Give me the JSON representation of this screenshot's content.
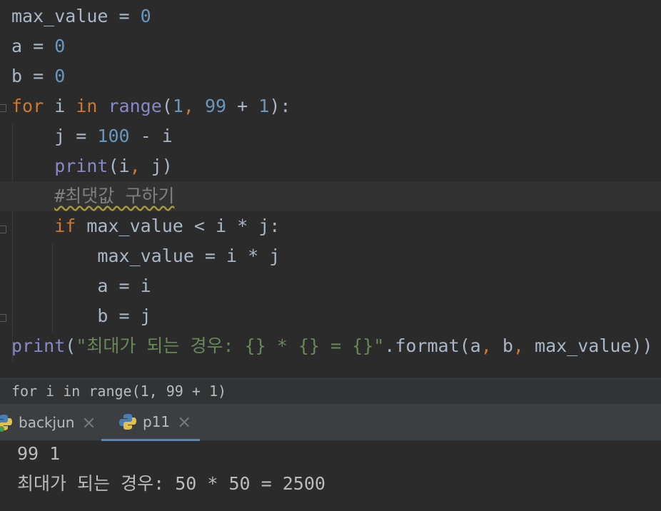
{
  "editor": {
    "lines": [
      {
        "segments": [
          {
            "t": "max_value = ",
            "c": "op"
          },
          {
            "t": "0",
            "c": "num"
          }
        ]
      },
      {
        "segments": [
          {
            "t": "a = ",
            "c": "op"
          },
          {
            "t": "0",
            "c": "num"
          }
        ]
      },
      {
        "segments": [
          {
            "t": "b = ",
            "c": "op"
          },
          {
            "t": "0",
            "c": "num"
          }
        ]
      },
      {
        "segments": [
          {
            "t": "for",
            "c": "kw"
          },
          {
            "t": " i ",
            "c": "op"
          },
          {
            "t": "in",
            "c": "kw"
          },
          {
            "t": " ",
            "c": "op"
          },
          {
            "t": "range",
            "c": "builtin"
          },
          {
            "t": "(",
            "c": "op"
          },
          {
            "t": "1",
            "c": "num"
          },
          {
            "t": ", ",
            "c": "kwcomma"
          },
          {
            "t": "99",
            "c": "num"
          },
          {
            "t": " + ",
            "c": "op"
          },
          {
            "t": "1",
            "c": "num"
          },
          {
            "t": "):",
            "c": "op"
          }
        ]
      },
      {
        "segments": [
          {
            "t": "    j = ",
            "c": "op"
          },
          {
            "t": "100",
            "c": "num"
          },
          {
            "t": " - i",
            "c": "op"
          }
        ]
      },
      {
        "segments": [
          {
            "t": "    ",
            "c": "op"
          },
          {
            "t": "print",
            "c": "builtin"
          },
          {
            "t": "(i",
            "c": "op"
          },
          {
            "t": ", ",
            "c": "kwcomma"
          },
          {
            "t": "j)",
            "c": "op"
          }
        ]
      },
      {
        "segments": [
          {
            "t": "    ",
            "c": "op"
          },
          {
            "t": "#최댓값 구하기",
            "c": "cmt"
          }
        ],
        "current": true
      },
      {
        "segments": [
          {
            "t": "    ",
            "c": "op"
          },
          {
            "t": "if",
            "c": "kw"
          },
          {
            "t": " max_value < i * j:",
            "c": "op"
          }
        ]
      },
      {
        "segments": [
          {
            "t": "        max_value = i * j",
            "c": "op"
          }
        ]
      },
      {
        "segments": [
          {
            "t": "        a = i",
            "c": "op"
          }
        ]
      },
      {
        "segments": [
          {
            "t": "        b = j",
            "c": "op"
          }
        ]
      },
      {
        "segments": [
          {
            "t": "print",
            "c": "builtin"
          },
          {
            "t": "(",
            "c": "op"
          },
          {
            "t": "\"최대가 되는 경우: {} * {} = {}\"",
            "c": "str"
          },
          {
            "t": ".format(a",
            "c": "op"
          },
          {
            "t": ", ",
            "c": "kwcomma"
          },
          {
            "t": "b",
            "c": "op"
          },
          {
            "t": ", ",
            "c": "kwcomma"
          },
          {
            "t": "max_value))",
            "c": "op"
          }
        ]
      }
    ]
  },
  "breadcrumb": {
    "text": "for i in range(1, 99 + 1)"
  },
  "tabs": {
    "items": [
      {
        "label": "backjun",
        "close": "×",
        "icon": "python-file-icon",
        "active": false
      },
      {
        "label": "p11",
        "close": "×",
        "icon": "python-file-icon",
        "active": true
      }
    ]
  },
  "console": {
    "lines": [
      "99 1",
      "최대가 되는 경우: 50 * 50 = 2500"
    ]
  },
  "colors": {
    "background": "#2b2b2b",
    "keyword": "#cc7832",
    "number": "#6897bb",
    "builtin": "#8888c6",
    "string": "#6a8759",
    "comment": "#808080",
    "text": "#a9b7c6"
  }
}
